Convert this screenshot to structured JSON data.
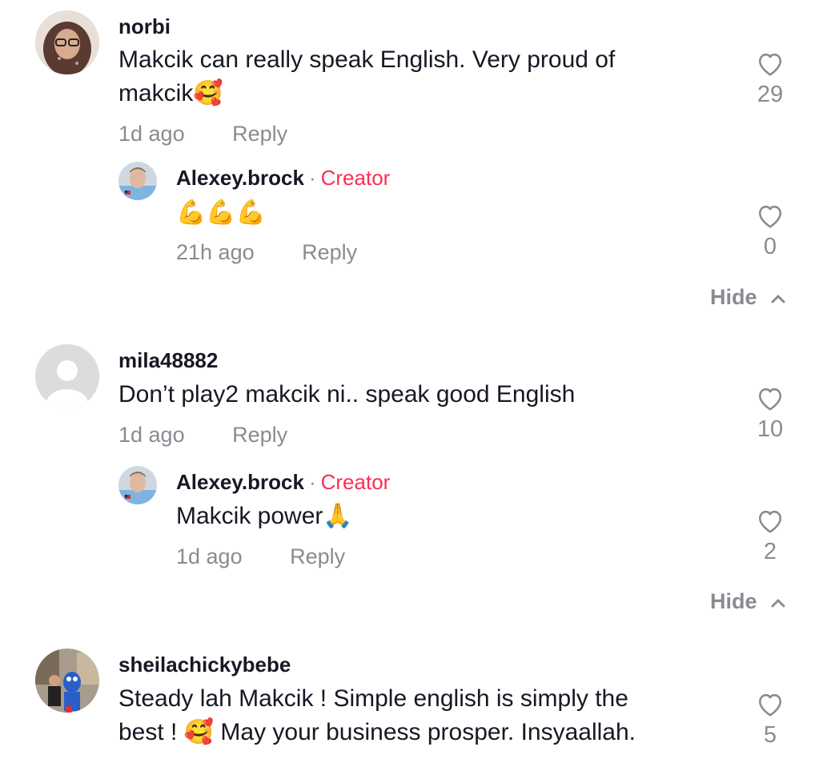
{
  "comments": [
    {
      "username": "norbi",
      "text_line1": "Makcik can really speak English. Very proud of",
      "text_line2": "makcik🥰",
      "time": "1d ago",
      "reply_label": "Reply",
      "likes": "29",
      "replies": [
        {
          "username": "Alexey.brock",
          "separator": "·",
          "badge": "Creator",
          "text": "💪💪💪",
          "time": "21h ago",
          "reply_label": "Reply",
          "likes": "0"
        }
      ],
      "hide_label": "Hide"
    },
    {
      "username": "mila48882",
      "text": "Don’t play2 makcik ni.. speak good English",
      "time": "1d ago",
      "reply_label": "Reply",
      "likes": "10",
      "replies": [
        {
          "username": "Alexey.brock",
          "separator": "·",
          "badge": "Creator",
          "text": "Makcik power🙏",
          "time": "1d ago",
          "reply_label": "Reply",
          "likes": "2"
        }
      ],
      "hide_label": "Hide"
    },
    {
      "username": "sheilachickybebe",
      "text_line1": "Steady lah Makcik ! Simple english is simply the",
      "text_line2": "best ! 🥰 May your business prosper. Insyaallah.",
      "likes": "5"
    }
  ],
  "icons": {
    "like": "heart-outline-icon",
    "collapse": "chevron-up-icon",
    "default_avatar": "default-avatar-icon"
  },
  "colors": {
    "creator_badge": "#fe2c55",
    "secondary_text": "#8a8b91",
    "primary_text": "#161823"
  }
}
